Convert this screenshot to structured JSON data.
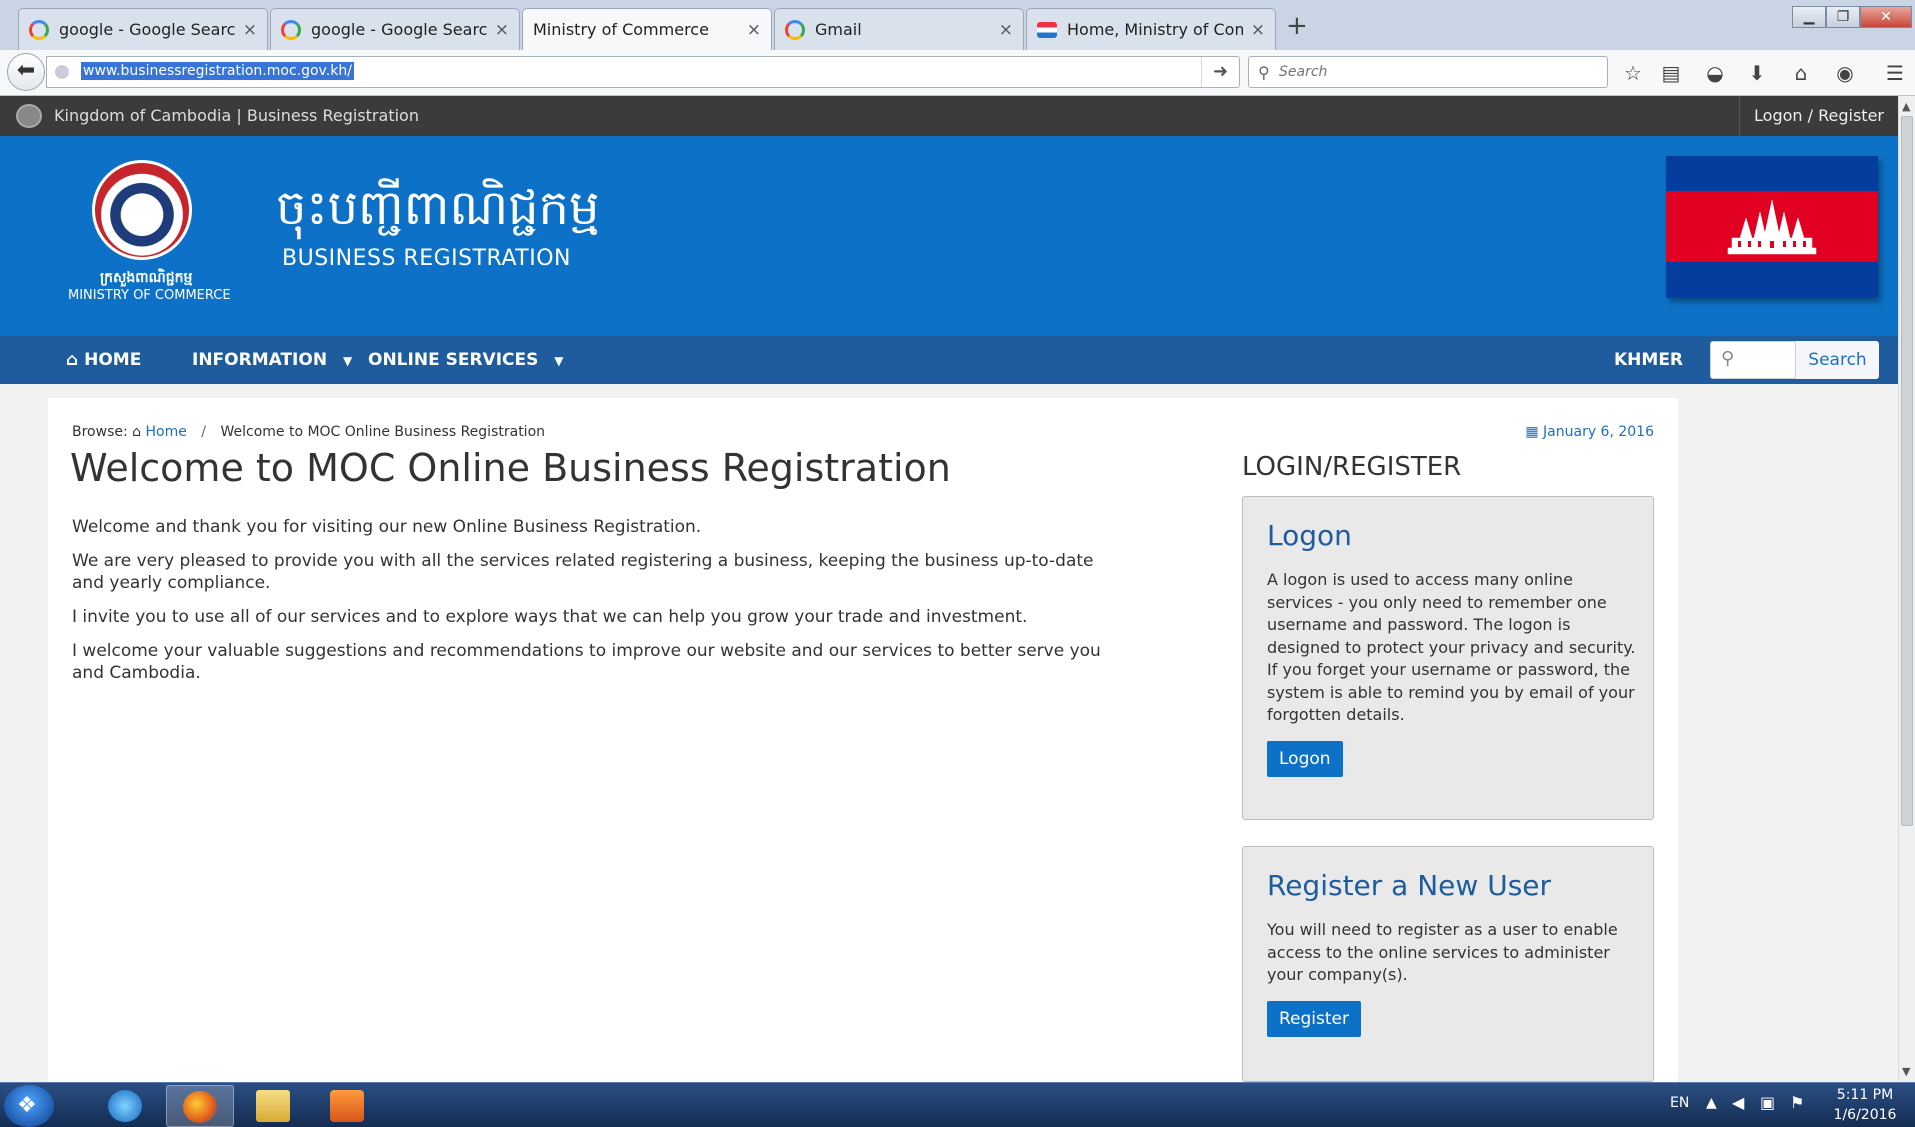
{
  "browser": {
    "tabs": [
      {
        "label": "google - Google Search",
        "icon": "google-icon"
      },
      {
        "label": "google - Google Search",
        "icon": "google-icon"
      },
      {
        "label": "Ministry of Commerce",
        "icon": "none",
        "active": true
      },
      {
        "label": "Gmail",
        "icon": "google-icon"
      },
      {
        "label": "Home, Ministry of Comme...",
        "icon": "moc-favicon"
      }
    ],
    "tab_close_glyph": "×",
    "new_tab_glyph": "+",
    "url": "www.businessregistration.moc.gov.kh/",
    "search_placeholder": "Search"
  },
  "page": {
    "top_strip": {
      "site_name": "Kingdom of Cambodia | Business Registration",
      "logon_link": "Logon / Register"
    },
    "header": {
      "logo_khmer": "ក្រសួងពាណិជ្ជកម្ម",
      "logo_english": "MINISTRY OF COMMERCE",
      "brand_khmer": "ចុះបញ្ជីពាណិជ្ជកម្ម",
      "brand_english": "BUSINESS REGISTRATION",
      "flag_colors": {
        "blue": "#033e9e",
        "red": "#e10021",
        "white": "#ffffff"
      }
    },
    "menu": {
      "home": "HOME",
      "information": "INFORMATION",
      "online_services": "ONLINE SERVICES",
      "language": "KHMER",
      "search_button": "Search"
    },
    "breadcrumb": {
      "prefix": "Browse:",
      "home": "Home",
      "separator": "/",
      "current": "Welcome to MOC Online Business Registration"
    },
    "date": "January 6, 2016",
    "title": "Welcome to MOC Online Business Registration",
    "paragraphs": [
      "Welcome and thank you for visiting our new Online Business Registration.",
      "We are very pleased to provide you with all the services related registering a business, keeping the business up-to-date and yearly compliance.",
      "I invite you to use all of our services and to explore ways that we can help you grow your trade and investment.",
      "I welcome your valuable suggestions and recommendations to improve our website and our services to better serve you and Cambodia."
    ],
    "sidebar": {
      "title": "LOGIN/REGISTER",
      "logon": {
        "heading": "Logon",
        "text": "A logon is used to access many online services - you only need to remember one username and password. The logon is designed to protect your privacy and security. If you forget your username or password, the system is able to remind you by email of your forgotten details.",
        "button": "Logon"
      },
      "register": {
        "heading": "Register a New User",
        "text": "You will need to register as a user to enable access to the online services to administer your company(s).",
        "button": "Register"
      }
    },
    "accent_color": "#0d72c7",
    "menu_color": "#1f5c9e"
  },
  "taskbar": {
    "language": "EN",
    "time": "5:11 PM",
    "date": "1/6/2016"
  }
}
